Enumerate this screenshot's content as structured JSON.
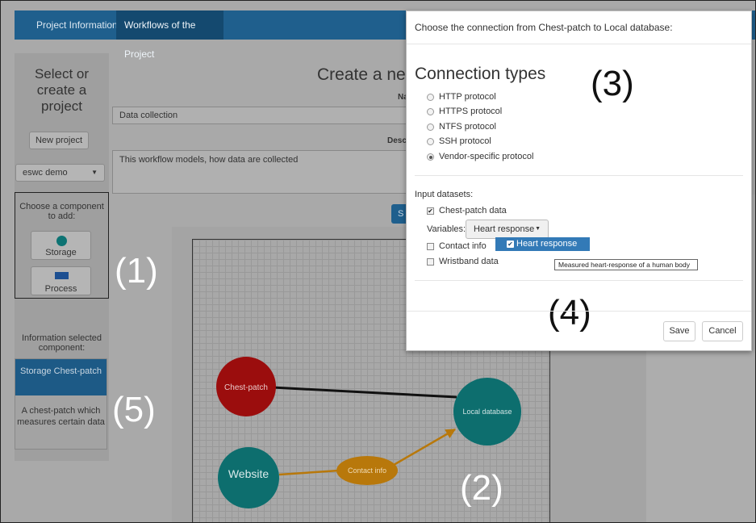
{
  "navbar": {
    "tabs": [
      {
        "label": "Project Information"
      },
      {
        "label": "Workflows of the Project"
      }
    ]
  },
  "sidebar": {
    "title": "Select or create a project",
    "new_project": "New project",
    "project_select": "eswc demo",
    "component_prompt": "Choose a component to add:",
    "components": [
      {
        "label": "Storage",
        "icon": "storage-circle-icon",
        "color": "#0d7373"
      },
      {
        "label": "Process",
        "icon": "process-rect-icon",
        "color": "#1d4f91"
      }
    ],
    "info_label": "Information selected component:",
    "selected": {
      "title": "Storage Chest-patch",
      "description": "A chest-patch which measures certain data"
    }
  },
  "main": {
    "title": "Create a ne",
    "name_label": "Na",
    "name_value": "Data collection",
    "desc_label": "Desc",
    "desc_value": "This workflow models, how data are collected",
    "save_stub": "S"
  },
  "canvas": {
    "nodes": [
      {
        "label": "Chest-patch",
        "color": "#9b0d0d"
      },
      {
        "label": "Local database",
        "color": "#0d6e6e"
      },
      {
        "label": "Website",
        "color": "#0d6e6e"
      },
      {
        "label": "Contact info",
        "color": "#b8780b"
      }
    ]
  },
  "annotations": {
    "one": "(1)",
    "two": "(2)",
    "three": "(3)",
    "four": "(4)",
    "five": "(5)"
  },
  "modal": {
    "title": "Choose the connection from Chest-patch to Local database:",
    "heading": "Connection types",
    "protocols": [
      {
        "label": "HTTP protocol",
        "selected": false
      },
      {
        "label": "HTTPS protocol",
        "selected": false
      },
      {
        "label": "NTFS protocol",
        "selected": false
      },
      {
        "label": "SSH protocol",
        "selected": false
      },
      {
        "label": "Vendor-specific protocol",
        "selected": true
      }
    ],
    "inputs_label": "Input datasets:",
    "datasets": [
      {
        "label": "Chest-patch data",
        "checked": true
      },
      {
        "label": "Contact info",
        "checked": false
      },
      {
        "label": "Wristband data",
        "checked": false
      }
    ],
    "variables_label": "Variables:",
    "variables_value": "Heart response",
    "dropdown_item": "Heart response",
    "tooltip": "Measured heart-response of a human body",
    "save": "Save",
    "cancel": "Cancel"
  }
}
